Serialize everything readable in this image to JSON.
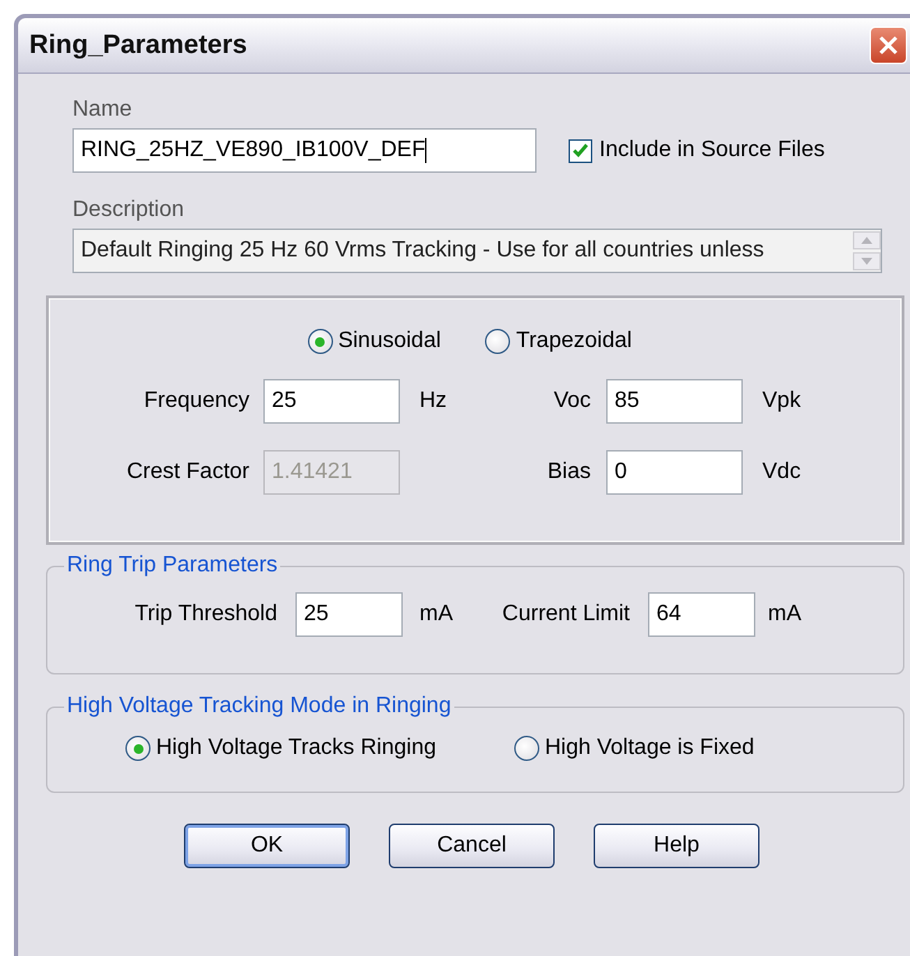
{
  "window": {
    "title": "Ring_Parameters"
  },
  "name_field": {
    "label": "Name",
    "value": "RING_25HZ_VE890_IB100V_DEF",
    "focused": true
  },
  "include_in_source": {
    "label": "Include in Source Files",
    "checked": true
  },
  "description_field": {
    "label": "Description",
    "value": "Default Ringing 25 Hz 60 Vrms Tracking - Use for all countries unless",
    "disabled": true
  },
  "waveform": {
    "options": [
      {
        "label": "Sinusoidal",
        "selected": true
      },
      {
        "label": "Trapezoidal",
        "selected": false
      }
    ],
    "fields": [
      {
        "label": "Frequency",
        "value": "25",
        "unit": "Hz",
        "disabled": false
      },
      {
        "label": "Voc",
        "value": "85",
        "unit": "Vpk",
        "disabled": false
      },
      {
        "label": "Crest Factor",
        "value": "1.41421",
        "disabled": true
      },
      {
        "label": "Bias",
        "value": "0",
        "unit": "Vdc",
        "disabled": false
      }
    ]
  },
  "ring_trip": {
    "title": "Ring Trip Parameters",
    "fields": [
      {
        "label": "Trip Threshold",
        "value": "25",
        "unit": "mA",
        "disabled": false
      },
      {
        "label": "Current Limit",
        "value": "64",
        "unit": "mA",
        "disabled": false
      }
    ]
  },
  "hv_tracking": {
    "title": "High Voltage Tracking Mode in Ringing",
    "options": [
      {
        "label": "High Voltage Tracks Ringing",
        "selected": true
      },
      {
        "label": "High Voltage is Fixed",
        "selected": false
      }
    ]
  },
  "buttons": [
    {
      "label": "OK",
      "default": true
    },
    {
      "label": "Cancel",
      "default": false
    },
    {
      "label": "Help",
      "default": false
    }
  ]
}
